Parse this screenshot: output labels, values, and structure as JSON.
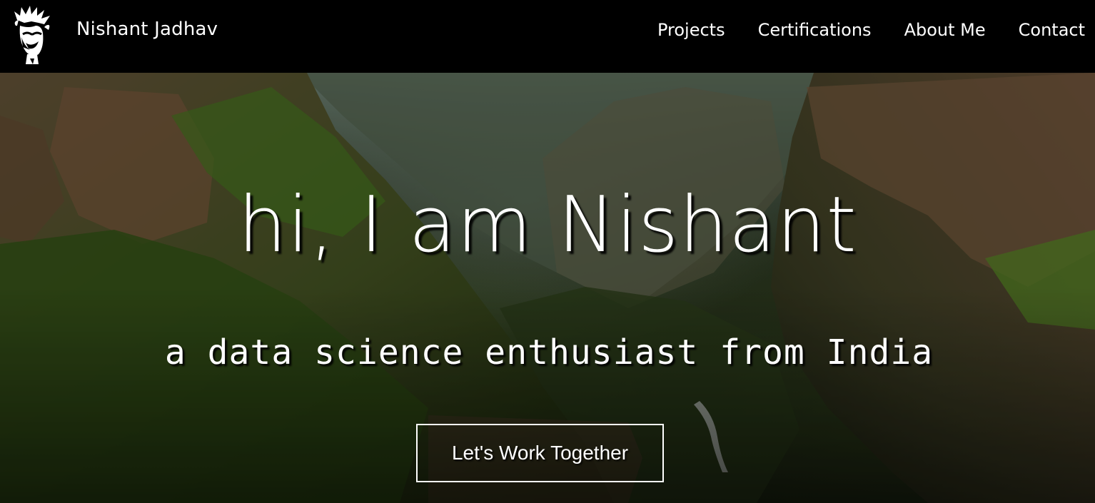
{
  "brand": {
    "name": "Nishant Jadhav",
    "logo_icon": "portrait-logo-icon"
  },
  "nav": {
    "items": [
      {
        "label": "Projects"
      },
      {
        "label": "Certifications"
      },
      {
        "label": "About Me"
      },
      {
        "label": "Contact"
      }
    ]
  },
  "hero": {
    "title": "hi, I am Nishant",
    "subtitle": "a data science enthusiast from India",
    "cta_label": "Let's Work Together"
  },
  "colors": {
    "navbar_bg": "#000000",
    "text": "#ffffff"
  }
}
